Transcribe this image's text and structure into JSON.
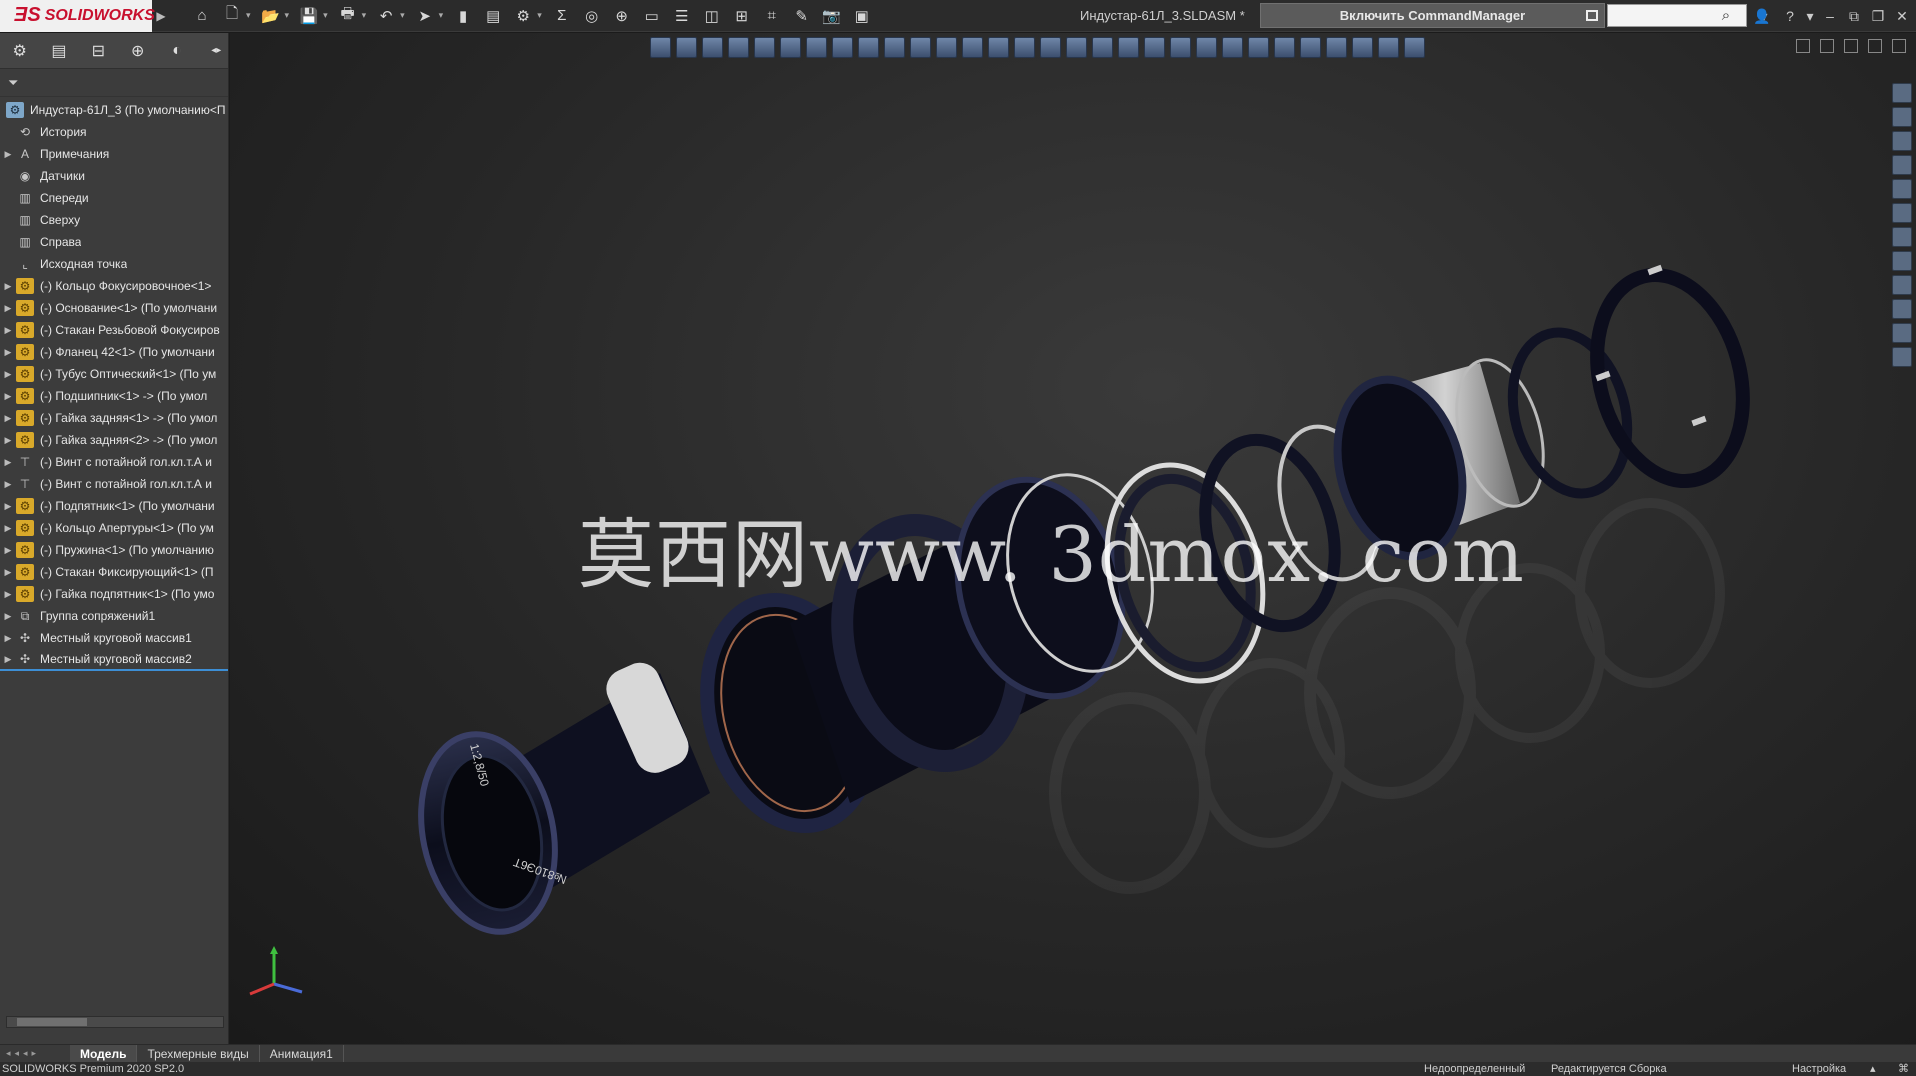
{
  "app": {
    "logo_text": "SOLIDWORKS",
    "doc_title": "Индустар-61Л_3.SLDASM *"
  },
  "toolbar": {
    "command_manager_label": "Включить CommandManager",
    "search_placeholder": ""
  },
  "tree": {
    "root": "Индустар-61Л_3  (По умолчанию<П",
    "items": [
      {
        "label": "История",
        "icon": "history-icon",
        "expandable": false
      },
      {
        "label": "Примечания",
        "icon": "annotations-icon",
        "expandable": true
      },
      {
        "label": "Датчики",
        "icon": "sensors-icon",
        "expandable": false
      },
      {
        "label": "Спереди",
        "icon": "plane-icon",
        "expandable": false
      },
      {
        "label": "Сверху",
        "icon": "plane-icon",
        "expandable": false
      },
      {
        "label": "Справа",
        "icon": "plane-icon",
        "expandable": false
      },
      {
        "label": "Исходная точка",
        "icon": "origin-icon",
        "expandable": false
      },
      {
        "label": "(-) Кольцо Фокусировочное<1>",
        "icon": "part-icon",
        "expandable": true
      },
      {
        "label": "(-) Основание<1> (По умолчани",
        "icon": "part-icon",
        "expandable": true
      },
      {
        "label": "(-) Стакан Резьбовой Фокусиров",
        "icon": "part-icon",
        "expandable": true
      },
      {
        "label": "(-) Фланец 42<1> (По умолчани",
        "icon": "part-icon",
        "expandable": true
      },
      {
        "label": "(-) Тубус Оптический<1> (По ум",
        "icon": "part-icon",
        "expandable": true
      },
      {
        "label": "(-) Подшипник<1> -> (По умол",
        "icon": "part-icon",
        "expandable": true
      },
      {
        "label": "(-) Гайка задняя<1> -> (По умол",
        "icon": "part-icon",
        "expandable": true
      },
      {
        "label": "(-) Гайка задняя<2> -> (По умол",
        "icon": "part-icon",
        "expandable": true
      },
      {
        "label": "(-) Винт с потайной гол.кл.т.А и",
        "icon": "screw-icon",
        "expandable": true
      },
      {
        "label": "(-) Винт с потайной гол.кл.т.А и",
        "icon": "screw-icon",
        "expandable": true
      },
      {
        "label": "(-) Подпятник<1> (По умолчани",
        "icon": "part-icon",
        "expandable": true
      },
      {
        "label": "(-) Кольцо Апертуры<1> (По ум",
        "icon": "part-icon",
        "expandable": true
      },
      {
        "label": "(-) Пружина<1> (По умолчанию",
        "icon": "part-icon",
        "expandable": true
      },
      {
        "label": "(-) Стакан Фиксирующий<1> (П",
        "icon": "part-icon",
        "expandable": true
      },
      {
        "label": "(-) Гайка подпятник<1> (По умо",
        "icon": "part-icon",
        "expandable": true
      },
      {
        "label": "Группа сопряжений1",
        "icon": "mates-icon",
        "expandable": true
      },
      {
        "label": "Местный круговой массив1",
        "icon": "pattern-icon",
        "expandable": true
      },
      {
        "label": "Местный круговой массив2",
        "icon": "pattern-icon",
        "expandable": true
      }
    ]
  },
  "viewport": {
    "watermark": "莫西网www. 3dmox. com",
    "lens_text_1": "№810Э6Т",
    "lens_text_2": "1:2,8/50"
  },
  "bottom_tabs": [
    "Модель",
    "Трехмерные виды",
    "Анимация1"
  ],
  "status": {
    "app_version": "SOLIDWORKS Premium 2020 SP2.0",
    "state": "Недоопределенный",
    "editing": "Редактируется Сборка",
    "settings": "Настройка"
  },
  "colors": {
    "part_icon": "#d9a92a",
    "brand_red": "#c8102e",
    "panel_bg": "#3c3c3c"
  }
}
